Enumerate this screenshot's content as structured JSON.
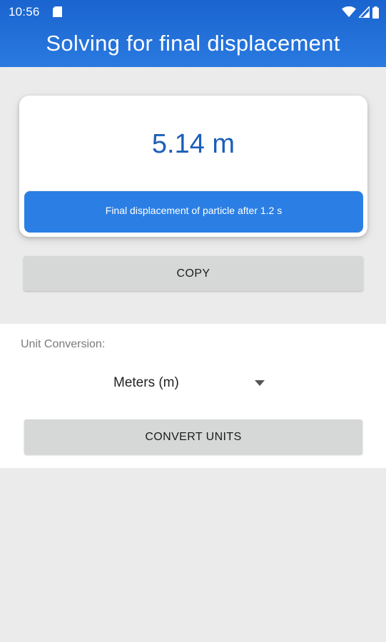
{
  "status_bar": {
    "time": "10:56",
    "icons": [
      "sd-card-icon",
      "wifi-icon",
      "signal-icon",
      "battery-icon"
    ]
  },
  "header": {
    "title": "Solving for final displacement"
  },
  "result": {
    "value": "5.14 m",
    "caption": "Final displacement of particle after 1.2 s"
  },
  "actions": {
    "copy_label": "COPY",
    "convert_label": "CONVERT UNITS"
  },
  "conversion": {
    "label": "Unit Conversion:",
    "selected_unit": "Meters (m)"
  },
  "colors": {
    "header": "#2a7ae0",
    "value_text": "#1c5fb8",
    "caption_bar": "#2b7fe4",
    "button": "#d6d7d7",
    "background": "#ebebeb"
  }
}
